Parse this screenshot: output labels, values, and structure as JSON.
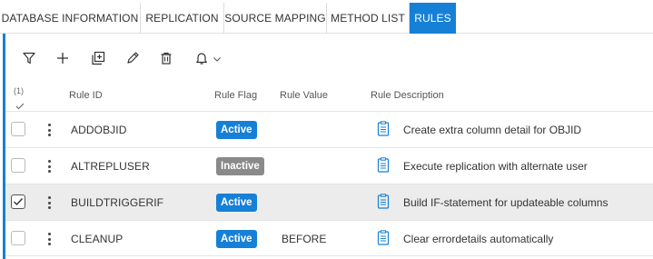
{
  "tabs": [
    {
      "label": "DATABASE INFORMATION",
      "active": false
    },
    {
      "label": "REPLICATION",
      "active": false
    },
    {
      "label": "SOURCE MAPPING",
      "active": false
    },
    {
      "label": "METHOD LIST",
      "active": false
    },
    {
      "label": "RULES",
      "active": true
    }
  ],
  "toolbar": {
    "icons": [
      "filter-icon",
      "add-icon",
      "duplicate-icon",
      "edit-icon",
      "delete-icon",
      "bell-icon",
      "chevron-down-icon"
    ]
  },
  "table": {
    "selected_count": "(1)",
    "columns": {
      "rule_id": "Rule ID",
      "rule_flag": "Rule Flag",
      "rule_value": "Rule Value",
      "rule_description": "Rule Description"
    },
    "rows": [
      {
        "rule_id": "ADDOBJID",
        "flag": "Active",
        "value": "",
        "description": "Create extra column detail for OBJID",
        "selected": false
      },
      {
        "rule_id": "ALTREPLUSER",
        "flag": "Inactive",
        "value": "",
        "description": "Execute replication with alternate user",
        "selected": false
      },
      {
        "rule_id": "BUILDTRIGGERIF",
        "flag": "Active",
        "value": "",
        "description": "Build IF-statement for updateable columns",
        "selected": true
      },
      {
        "rule_id": "CLEANUP",
        "flag": "Active",
        "value": "BEFORE",
        "description": "Clear errordetails automatically",
        "selected": false
      }
    ]
  },
  "colors": {
    "accent": "#1680d6",
    "inactive_badge": "#8a8a8a",
    "selected_row": "#ececec"
  }
}
